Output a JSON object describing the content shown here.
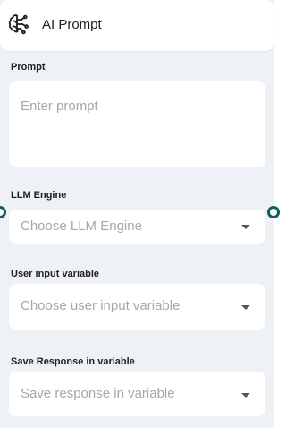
{
  "node": {
    "title": "AI Prompt",
    "icon": "brain-icon"
  },
  "fields": {
    "prompt": {
      "label": "Prompt",
      "placeholder": "Enter prompt"
    },
    "llm_engine": {
      "label": "LLM Engine",
      "placeholder": "Choose LLM Engine"
    },
    "user_input_variable": {
      "label": "User input variable",
      "placeholder": "Choose user input variable"
    },
    "save_response": {
      "label": "Save Response in variable",
      "placeholder": "Save response in variable"
    }
  },
  "colors": {
    "panel_background": "#eef1f5",
    "handle_border": "#0f5f5f",
    "placeholder_text": "#a7a7a7"
  }
}
